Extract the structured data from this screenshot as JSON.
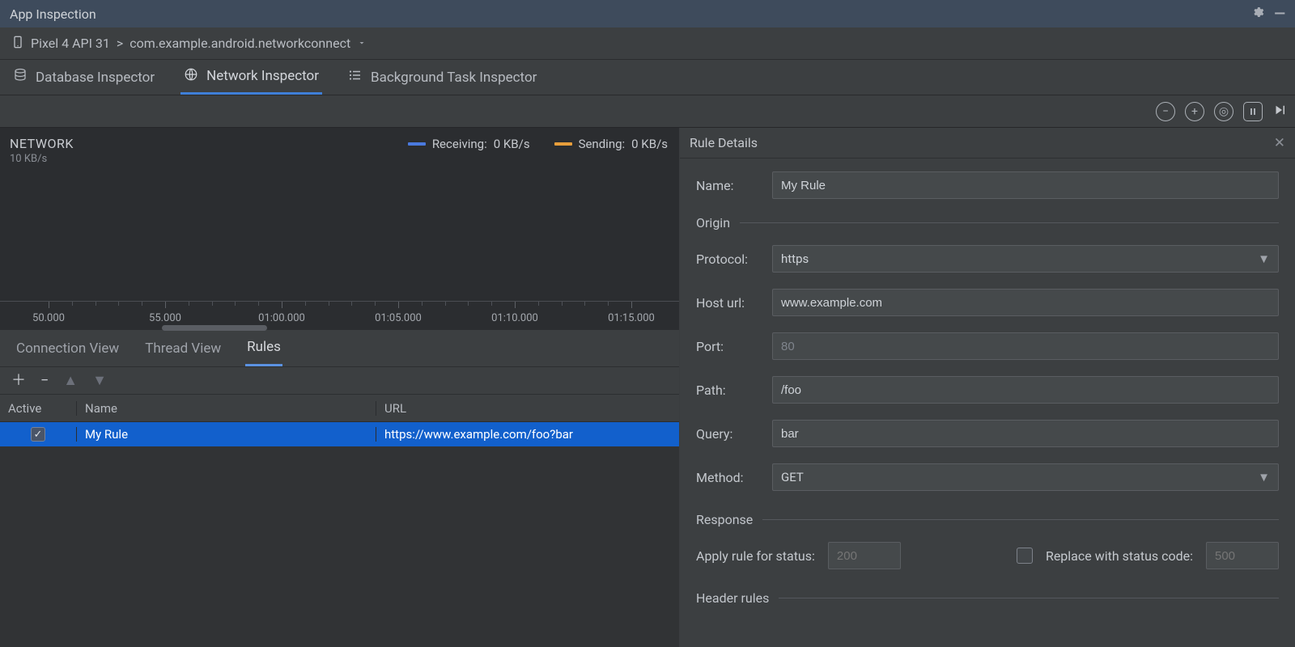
{
  "title": "App Inspection",
  "breadcrumb": {
    "device": "Pixel 4 API 31",
    "separator": ">",
    "process": "com.example.android.networkconnect"
  },
  "inspector_tabs": [
    {
      "icon": "database-icon",
      "label": "Database Inspector",
      "active": false
    },
    {
      "icon": "globe-icon",
      "label": "Network Inspector",
      "active": true
    },
    {
      "icon": "list-icon",
      "label": "Background Task Inspector",
      "active": false
    }
  ],
  "toolbar_icons": [
    "minus-circle-icon",
    "plus-circle-icon",
    "target-icon",
    "pause-icon",
    "play-end-icon"
  ],
  "network_panel": {
    "title": "NETWORK",
    "legend": {
      "receiving": {
        "label": "Receiving:",
        "value": "0 KB/s"
      },
      "sending": {
        "label": "Sending:",
        "value": "0 KB/s"
      }
    },
    "yscale_label": "10 KB/s",
    "time_ticks": [
      "50.000",
      "55.000",
      "01:00.000",
      "01:05.000",
      "01:10.000",
      "01:15.000"
    ]
  },
  "sub_tabs": [
    {
      "label": "Connection View",
      "active": false
    },
    {
      "label": "Thread View",
      "active": false
    },
    {
      "label": "Rules",
      "active": true
    }
  ],
  "rules_toolbar": {
    "add_icon": "plus-icon",
    "remove_icon": "minus-icon",
    "up_icon": "up-icon",
    "down_icon": "down-icon"
  },
  "rules_table": {
    "headers": {
      "active": "Active",
      "name": "Name",
      "url": "URL"
    },
    "rows": [
      {
        "active": true,
        "name": "My Rule",
        "url": "https://www.example.com/foo?bar"
      }
    ]
  },
  "details": {
    "title": "Rule Details",
    "name_label": "Name:",
    "name_value": "My Rule",
    "origin_label": "Origin",
    "protocol_label": "Protocol:",
    "protocol_value": "https",
    "host_label": "Host url:",
    "host_value": "www.example.com",
    "port_label": "Port:",
    "port_placeholder": "80",
    "path_label": "Path:",
    "path_value": "/foo",
    "query_label": "Query:",
    "query_value": "bar",
    "method_label": "Method:",
    "method_value": "GET",
    "response_label": "Response",
    "apply_status_label": "Apply rule for status:",
    "apply_status_placeholder": "200",
    "replace_status_label": "Replace with status code:",
    "replace_status_placeholder": "500",
    "header_rules_label": "Header rules"
  }
}
